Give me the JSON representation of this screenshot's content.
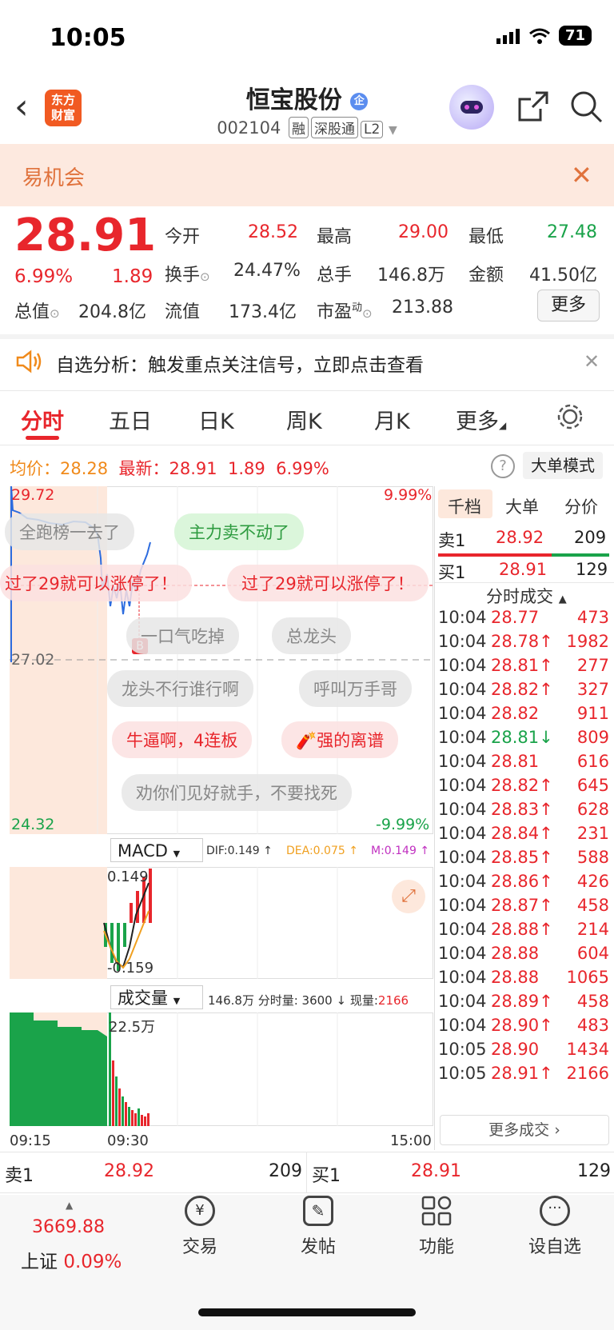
{
  "status_bar": {
    "time": "10:05",
    "battery": "71"
  },
  "header": {
    "back_icon": "chevron-left-icon",
    "app_logo": "东方\n财富",
    "stock_name": "恒宝股份",
    "stock_code": "002104",
    "tags": [
      "融",
      "深股通",
      "L2"
    ]
  },
  "banner": {
    "text": "易机会"
  },
  "quote": {
    "price": "28.91",
    "change_pct": "6.99%",
    "change": "1.89",
    "open_label": "今开",
    "open": "28.52",
    "high_label": "最高",
    "high": "29.00",
    "low_label": "最低",
    "low": "27.48",
    "turnover_label": "换手",
    "turnover": "24.47%",
    "volume_label": "总手",
    "volume": "146.8万",
    "amount_label": "金额",
    "amount": "41.50亿",
    "mktcap_label": "总值",
    "mktcap": "204.8亿",
    "float_label": "流值",
    "float": "173.4亿",
    "pe_label": "市盈",
    "pe_sup": "动",
    "pe": "213.88",
    "more": "更多"
  },
  "notice": {
    "text": "自选分析：触发重点关注信号，立即点击查看"
  },
  "tabs": [
    "分时",
    "五日",
    "日K",
    "周K",
    "月K",
    "更多"
  ],
  "intraday": {
    "avg_label": "均价：",
    "avg": "28.28",
    "latest_label": "最新：",
    "latest": "28.91",
    "latest_chg": "1.89",
    "latest_pct": "6.99%",
    "mode_button": "大单模式",
    "y_top": "29.72",
    "y_mid": "27.02",
    "y_bottom": "24.32",
    "pct_top": "9.99%",
    "pct_bottom": "-9.99%",
    "bubbles": [
      "全跑榜一去了",
      "主力卖不动了",
      "过了29就可以涨停了！",
      "过了29就可以涨停了！",
      "一口气吃掉",
      "总龙头",
      "龙头不行谁行啊",
      "呼叫万手哥",
      "牛逼啊，4连板",
      "强的离谱",
      "劝你们见好就手，不要找死"
    ],
    "buy_marker": "B"
  },
  "macd": {
    "label": "MACD",
    "dif": "DIF:0.149 ↑",
    "dea": "DEA:0.075 ↑",
    "m": "M:0.149 ↑",
    "max": "0.149",
    "min": "-0.159"
  },
  "volume_panel": {
    "label": "成交量",
    "total": "146.8万",
    "fen": "分时量: 3600 ↓",
    "now_label": "现量:",
    "now": "2166",
    "max": "22.5万",
    "t_start": "09:15",
    "t_open": "09:30",
    "t_end": "15:00"
  },
  "right_panel": {
    "tabs": [
      "千档",
      "大单",
      "分价"
    ],
    "sell1": {
      "label": "卖1",
      "price": "28.92",
      "vol": "209"
    },
    "buy1": {
      "label": "买1",
      "price": "28.91",
      "vol": "129"
    },
    "ticks_title": "分时成交",
    "ticks": [
      {
        "t": "10:04",
        "p": "28.77",
        "v": "473"
      },
      {
        "t": "10:04",
        "p": "28.78↑",
        "v": "1982"
      },
      {
        "t": "10:04",
        "p": "28.81↑",
        "v": "277"
      },
      {
        "t": "10:04",
        "p": "28.82↑",
        "v": "327"
      },
      {
        "t": "10:04",
        "p": "28.82",
        "v": "911"
      },
      {
        "t": "10:04",
        "p": "28.81↓",
        "v": "809"
      },
      {
        "t": "10:04",
        "p": "28.81",
        "v": "616"
      },
      {
        "t": "10:04",
        "p": "28.82↑",
        "v": "645"
      },
      {
        "t": "10:04",
        "p": "28.83↑",
        "v": "628"
      },
      {
        "t": "10:04",
        "p": "28.84↑",
        "v": "231"
      },
      {
        "t": "10:04",
        "p": "28.85↑",
        "v": "588"
      },
      {
        "t": "10:04",
        "p": "28.86↑",
        "v": "426"
      },
      {
        "t": "10:04",
        "p": "28.87↑",
        "v": "458"
      },
      {
        "t": "10:04",
        "p": "28.88↑",
        "v": "214"
      },
      {
        "t": "10:04",
        "p": "28.88",
        "v": "604"
      },
      {
        "t": "10:04",
        "p": "28.88",
        "v": "1065"
      },
      {
        "t": "10:04",
        "p": "28.89↑",
        "v": "458"
      },
      {
        "t": "10:04",
        "p": "28.90↑",
        "v": "483"
      },
      {
        "t": "10:05",
        "p": "28.90",
        "v": "1434"
      },
      {
        "t": "10:05",
        "p": "28.91↑",
        "v": "2166"
      }
    ],
    "more_ticks": "更多成交 ›"
  },
  "order_bar": {
    "sell_label": "卖1",
    "sell_price": "28.92",
    "sell_vol": "209",
    "buy_label": "买1",
    "buy_price": "28.91",
    "buy_vol": "129"
  },
  "bottom_nav": {
    "index_value": "3669.88",
    "index_name": "上证",
    "index_pct": "0.09%",
    "items": [
      "交易",
      "发帖",
      "功能",
      "设自选"
    ]
  }
}
